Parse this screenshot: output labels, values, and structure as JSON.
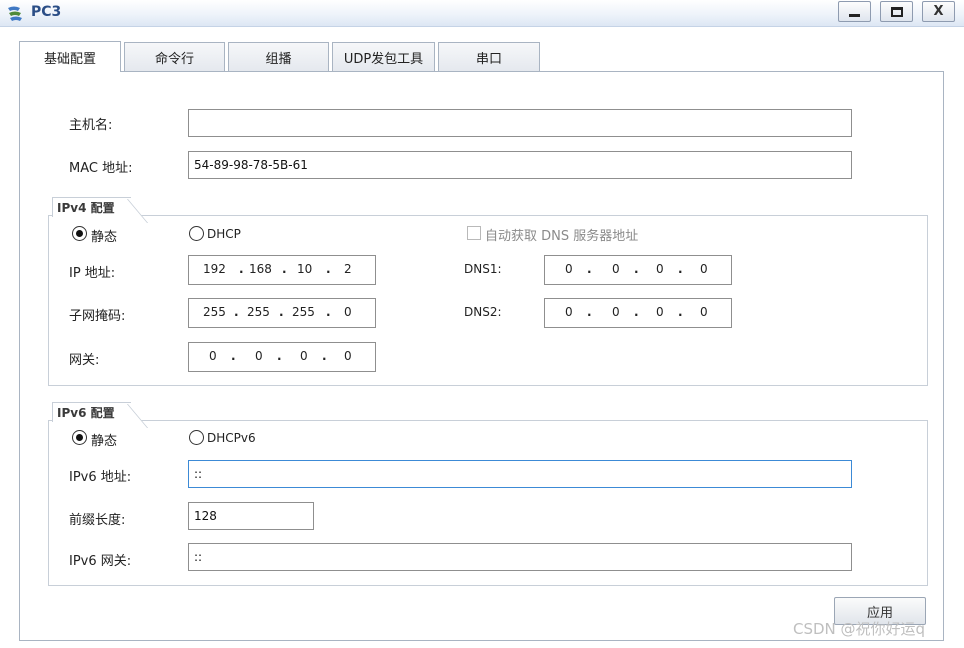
{
  "window": {
    "title": "PC3",
    "minimize_label": "_",
    "maximize_label": "□",
    "close_label": "X"
  },
  "tabs": [
    {
      "label": "基础配置",
      "active": true
    },
    {
      "label": "命令行"
    },
    {
      "label": "组播"
    },
    {
      "label": "UDP发包工具"
    },
    {
      "label": "串口"
    }
  ],
  "basic": {
    "hostname_label": "主机名:",
    "hostname_value": "",
    "mac_label": "MAC 地址:",
    "mac_value": "54-89-98-78-5B-61"
  },
  "ipv4": {
    "group_title": "IPv4 配置",
    "static_label": "静态",
    "static_selected": true,
    "dhcp_label": "DHCP",
    "auto_dns_label": "自动获取 DNS 服务器地址",
    "auto_dns_checked": false,
    "ip_label": "IP 地址:",
    "ip": [
      "192",
      "168",
      "10",
      "2"
    ],
    "mask_label": "子网掩码:",
    "mask": [
      "255",
      "255",
      "255",
      "0"
    ],
    "gateway_label": "网关:",
    "gateway": [
      "0",
      "0",
      "0",
      "0"
    ],
    "dns1_label": "DNS1:",
    "dns1": [
      "0",
      "0",
      "0",
      "0"
    ],
    "dns2_label": "DNS2:",
    "dns2": [
      "0",
      "0",
      "0",
      "0"
    ]
  },
  "ipv6": {
    "group_title": "IPv6 配置",
    "static_label": "静态",
    "static_selected": true,
    "dhcp_label": "DHCPv6",
    "addr_label": "IPv6 地址:",
    "addr_value": "::",
    "prefix_label": "前缀长度:",
    "prefix_value": "128",
    "gateway_label": "IPv6 网关:",
    "gateway_value": "::"
  },
  "apply_label": "应用",
  "watermark": "CSDN @祝你好运q"
}
